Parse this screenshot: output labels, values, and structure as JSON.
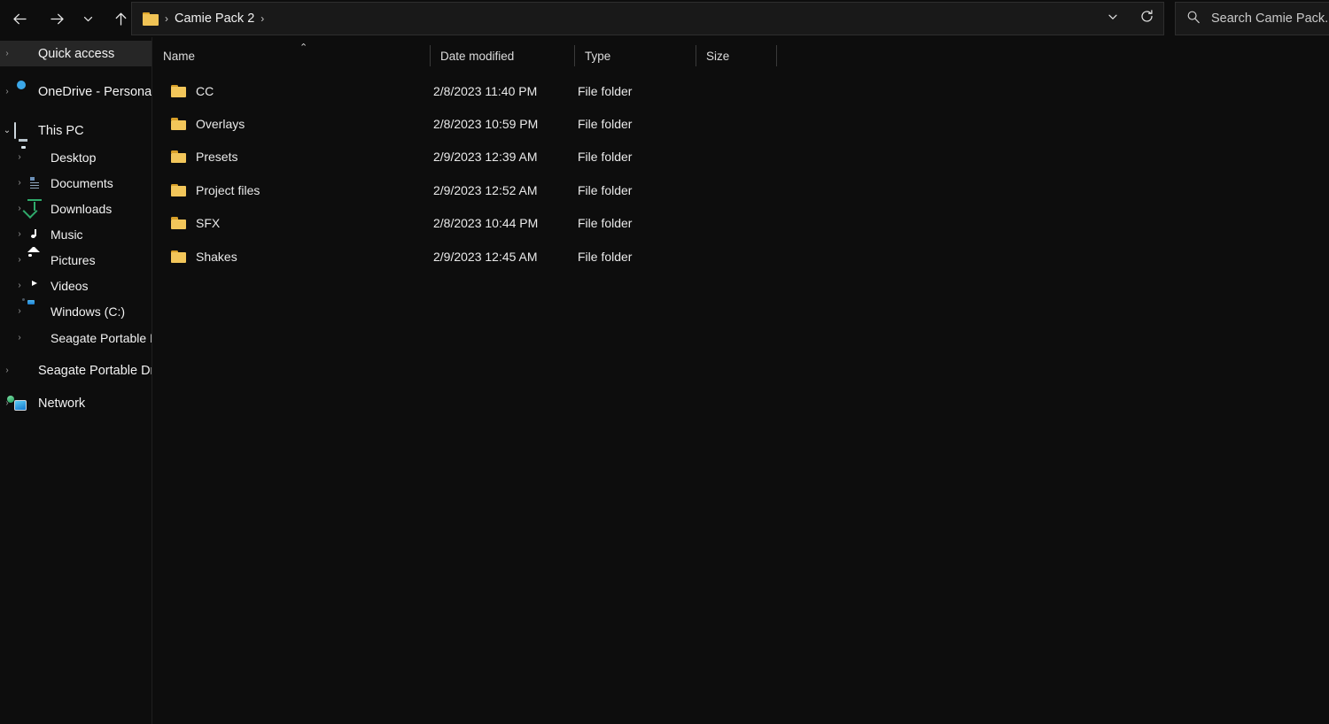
{
  "window": {
    "title": "Camie Pack 2",
    "theme": "dark",
    "colors": {
      "background": "#0d0d0d",
      "field": "#191919",
      "border": "#2e2e2e",
      "selection": "#262626",
      "text": "#f2f2f2",
      "folder_accent": "#f2c65a"
    }
  },
  "toolbar": {
    "back_tooltip": "Back",
    "forward_tooltip": "Forward",
    "recent_tooltip": "Recent locations",
    "up_tooltip": "Up",
    "address_dropdown_tooltip": "Previous locations",
    "refresh_tooltip": "Refresh",
    "icons": {
      "back": "arrow-left-icon",
      "forward": "arrow-right-icon",
      "recent": "chevron-down-icon",
      "up": "arrow-up-icon",
      "dropdown": "chevron-down-icon",
      "refresh": "refresh-icon",
      "search": "search-icon"
    }
  },
  "address": {
    "folder_icon": "folder-icon",
    "separator": "›",
    "crumbs": [
      "Camie Pack 2"
    ],
    "trailing_separator": "›"
  },
  "search": {
    "placeholder": "Search Camie Pack...",
    "value": ""
  },
  "sidebar": {
    "items": [
      {
        "label": "Quick access",
        "icon": "star-icon",
        "level": 0,
        "expander": "›",
        "expanded": false,
        "selected": true
      },
      {
        "label": "OneDrive - Personal",
        "icon": "cloud-icon",
        "level": 0,
        "expander": "›",
        "expanded": false,
        "selected": false
      },
      {
        "label": "This PC",
        "icon": "monitor-icon",
        "level": 0,
        "expander": "⌄",
        "expanded": true,
        "selected": false
      },
      {
        "label": "Desktop",
        "icon": "desktop-icon",
        "level": 1,
        "expander": "›",
        "expanded": false,
        "selected": false
      },
      {
        "label": "Documents",
        "icon": "document-icon",
        "level": 1,
        "expander": "›",
        "expanded": false,
        "selected": false
      },
      {
        "label": "Downloads",
        "icon": "download-icon",
        "level": 1,
        "expander": "›",
        "expanded": false,
        "selected": false
      },
      {
        "label": "Music",
        "icon": "music-note-icon",
        "level": 1,
        "expander": "›",
        "expanded": false,
        "selected": false
      },
      {
        "label": "Pictures",
        "icon": "picture-icon",
        "level": 1,
        "expander": "›",
        "expanded": false,
        "selected": false
      },
      {
        "label": "Videos",
        "icon": "video-icon",
        "level": 1,
        "expander": "›",
        "expanded": false,
        "selected": false
      },
      {
        "label": "Windows (C:)",
        "icon": "hard-drive-icon",
        "level": 1,
        "expander": "›",
        "expanded": false,
        "selected": false
      },
      {
        "label": "Seagate Portable Dr",
        "icon": "external-drive-icon",
        "level": 1,
        "expander": "›",
        "expanded": false,
        "selected": false
      },
      {
        "label": "Seagate Portable Driv",
        "icon": "external-drive-icon",
        "level": 0,
        "expander": "›",
        "expanded": false,
        "selected": false
      },
      {
        "label": "Network",
        "icon": "network-icon",
        "level": 0,
        "expander": "›",
        "expanded": false,
        "selected": false
      }
    ]
  },
  "columns": {
    "name": "Name",
    "date_modified": "Date modified",
    "type": "Type",
    "size": "Size",
    "sort_by": "Name",
    "sort_direction": "ascending",
    "sort_caret": "⌃"
  },
  "files": {
    "rows": [
      {
        "name": "CC",
        "date_modified": "2/8/2023 11:40 PM",
        "type": "File folder",
        "size": "",
        "icon": "folder-icon"
      },
      {
        "name": "Overlays",
        "date_modified": "2/8/2023 10:59 PM",
        "type": "File folder",
        "size": "",
        "icon": "folder-icon"
      },
      {
        "name": "Presets",
        "date_modified": "2/9/2023 12:39 AM",
        "type": "File folder",
        "size": "",
        "icon": "folder-icon"
      },
      {
        "name": "Project files",
        "date_modified": "2/9/2023 12:52 AM",
        "type": "File folder",
        "size": "",
        "icon": "folder-icon"
      },
      {
        "name": "SFX",
        "date_modified": "2/8/2023 10:44 PM",
        "type": "File folder",
        "size": "",
        "icon": "folder-icon"
      },
      {
        "name": "Shakes",
        "date_modified": "2/9/2023 12:45 AM",
        "type": "File folder",
        "size": "",
        "icon": "folder-icon"
      }
    ]
  }
}
